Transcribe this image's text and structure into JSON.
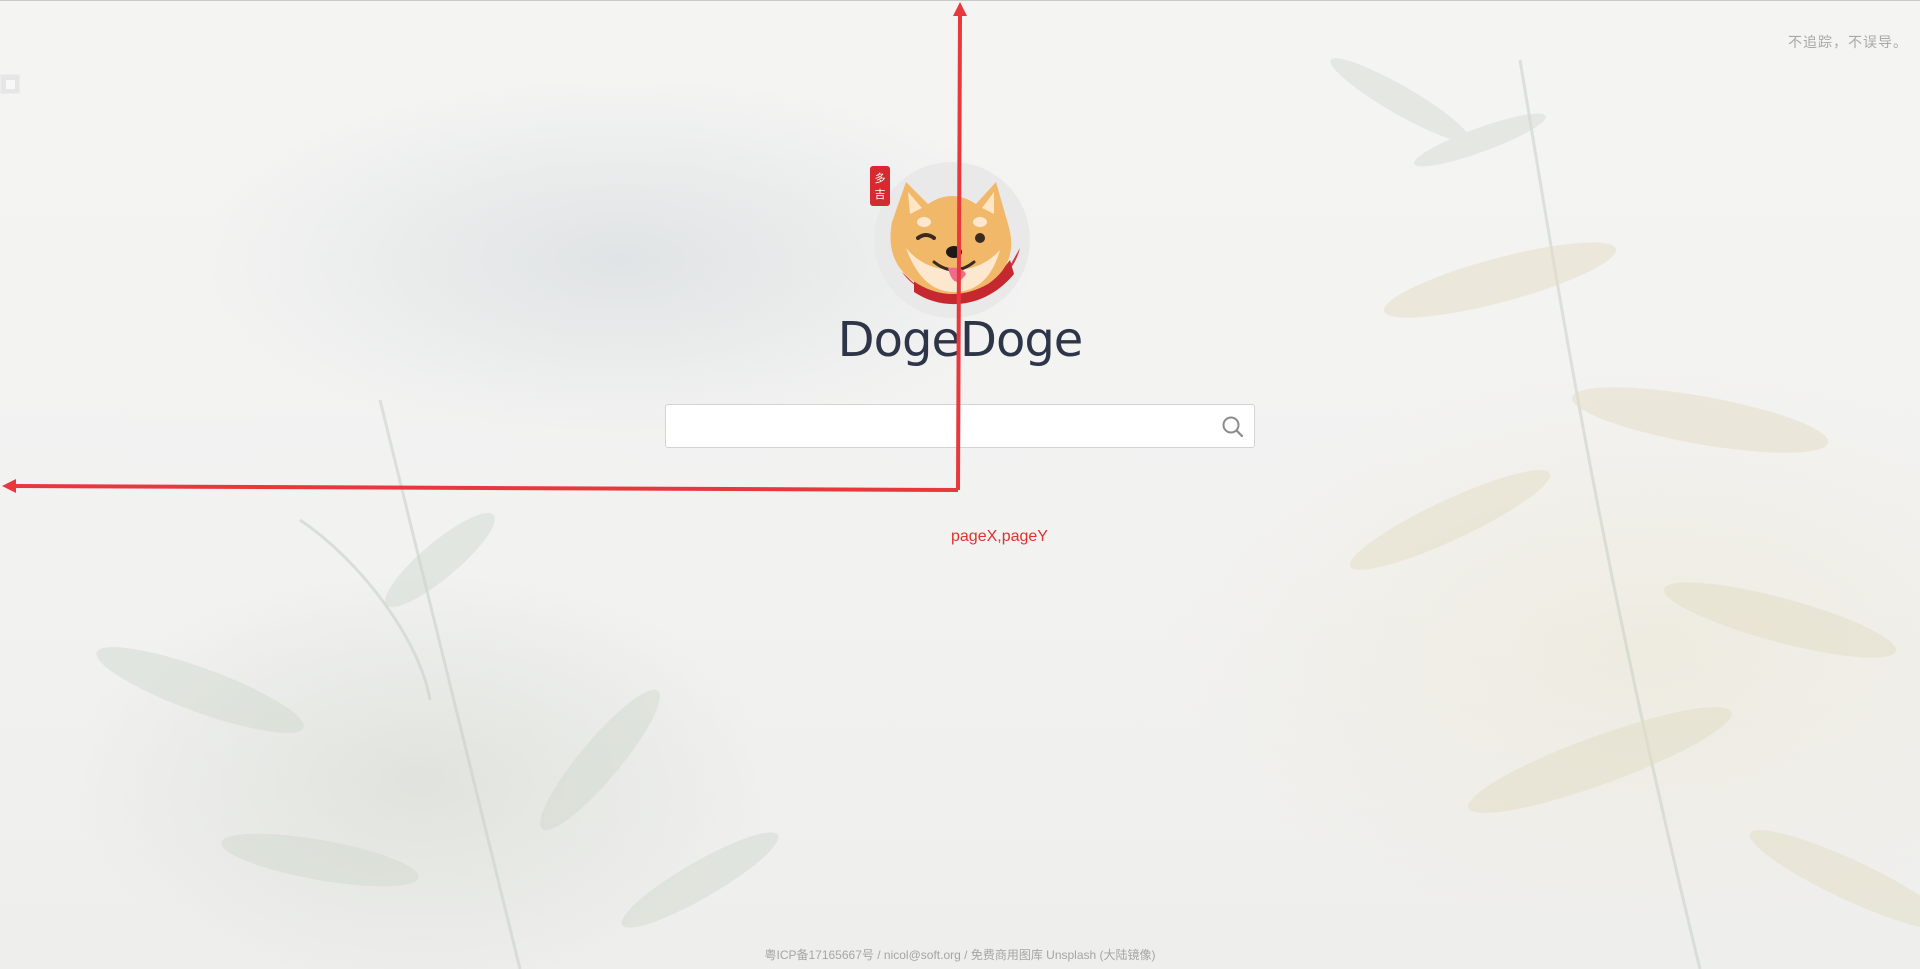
{
  "header": {
    "tagline": "不追踪，不误导。"
  },
  "brand": {
    "name": "DogeDoge",
    "seal_text": "多吉"
  },
  "search": {
    "value": "",
    "placeholder": ""
  },
  "annotation": {
    "label": "pageX,pageY",
    "color": "#e03131"
  },
  "footer": {
    "icp": "粤ICP备17165667号",
    "separator1": " / ",
    "email": "nicol@soft.org",
    "separator2": " / ",
    "credit": "免费商用图库 Unsplash (大陆镜像)"
  },
  "icons": {
    "search": "search-icon",
    "logo": "shiba-dog-logo-icon"
  }
}
